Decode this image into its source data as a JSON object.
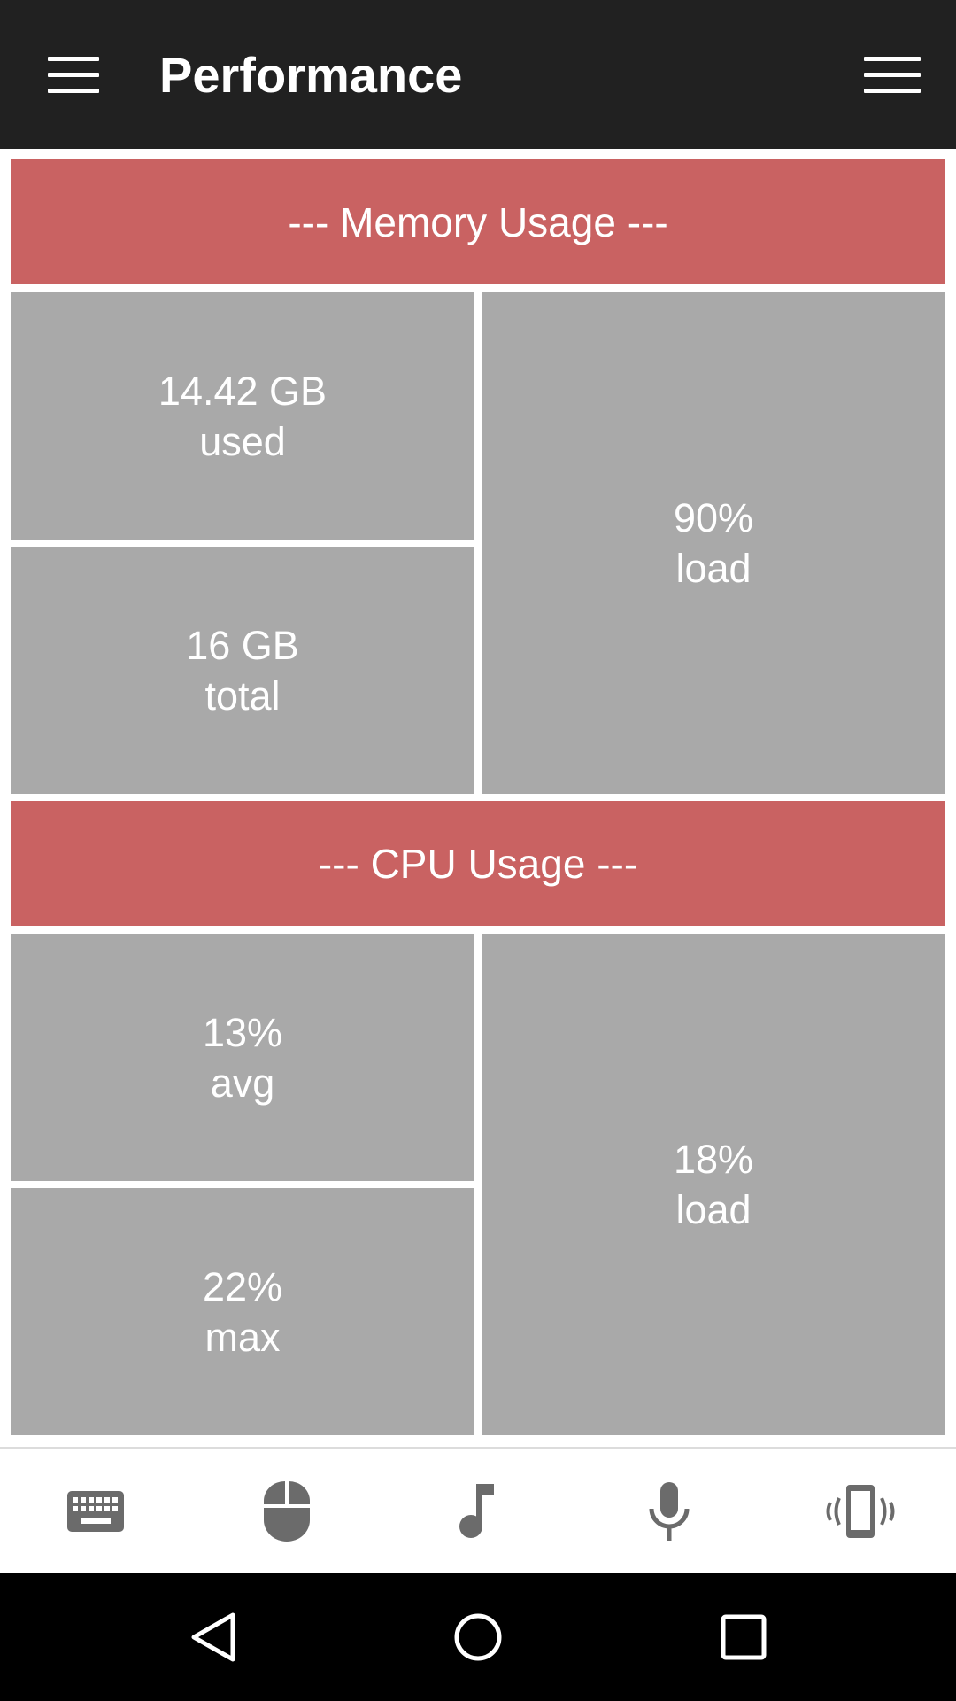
{
  "appbar": {
    "title": "Performance",
    "menu_icon": "hamburger-menu-icon",
    "overflow_icon": "menu-icon"
  },
  "memory": {
    "header": "--- Memory Usage ---",
    "used_value": "14.42 GB",
    "used_label": "used",
    "total_value": "16 GB",
    "total_label": "total",
    "load_value": "90%",
    "load_label": "load"
  },
  "cpu": {
    "header": "--- CPU Usage ---",
    "avg_value": "13%",
    "avg_label": "avg",
    "max_value": "22%",
    "max_label": "max",
    "load_value": "18%",
    "load_label": "load"
  },
  "bottom_nav": {
    "items": [
      {
        "icon": "keyboard-icon"
      },
      {
        "icon": "mouse-icon"
      },
      {
        "icon": "music-note-icon"
      },
      {
        "icon": "microphone-icon"
      },
      {
        "icon": "phone-vibrate-icon"
      }
    ]
  },
  "system_nav": {
    "icons": [
      "back-icon",
      "home-icon",
      "recents-icon"
    ]
  },
  "colors": {
    "appbar_bg": "#212121",
    "header_bg": "#c96262",
    "tile_bg": "#a9a9a9",
    "icon_color": "#6b6b6b"
  }
}
